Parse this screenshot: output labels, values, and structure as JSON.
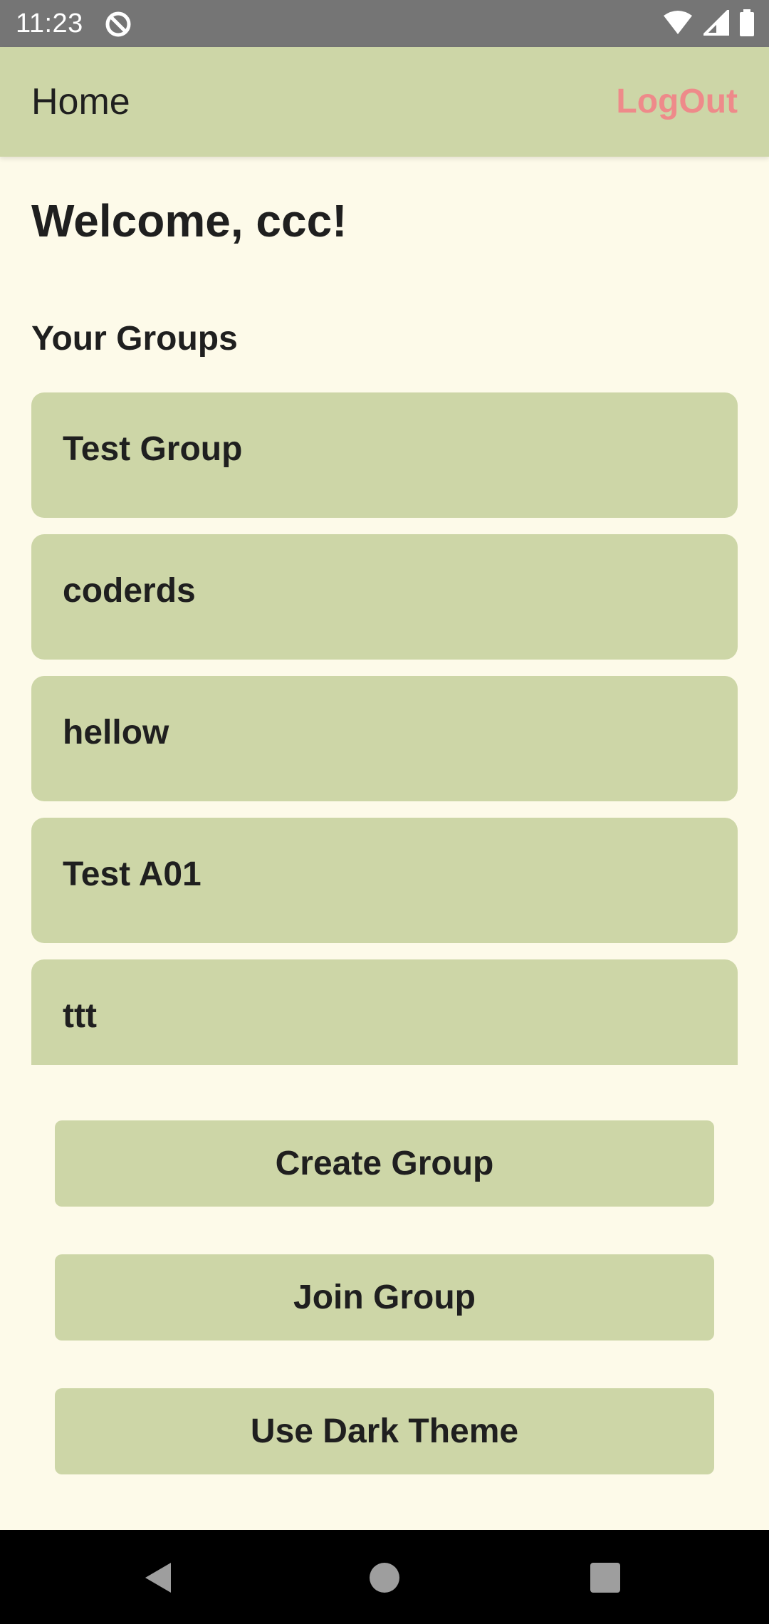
{
  "status_bar": {
    "time": "11:23",
    "icons": [
      "sync-icon",
      "wifi-icon",
      "cell-signal-icon",
      "battery-icon"
    ]
  },
  "app_bar": {
    "title": "Home",
    "logout_label": "LogOut"
  },
  "main": {
    "welcome": "Welcome, ccc!",
    "groups_heading": "Your Groups",
    "groups": [
      {
        "name": "Test Group"
      },
      {
        "name": "coderds"
      },
      {
        "name": "hellow"
      },
      {
        "name": "Test A01"
      },
      {
        "name": "ttt"
      }
    ]
  },
  "actions": {
    "create_group": "Create Group",
    "join_group": "Join Group",
    "dark_theme": "Use Dark Theme"
  },
  "nav_bar": {
    "icons": [
      "back-icon",
      "home-icon",
      "recents-icon"
    ]
  },
  "colors": {
    "background": "#fdfae9",
    "accent": "#cdd6a7",
    "logout": "#ee8a8a",
    "status_bar": "#757575",
    "nav_bar": "#000000"
  }
}
